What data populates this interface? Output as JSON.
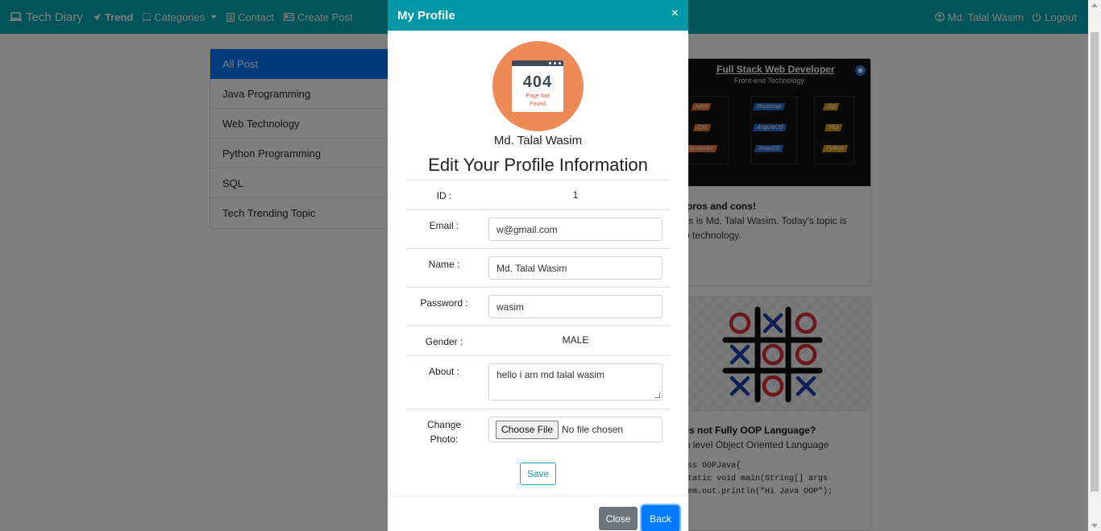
{
  "navbar": {
    "brand": "Tech Diary",
    "trend": "Trend",
    "categories": "Categories",
    "contact": "Contact",
    "create_post": "Create Post",
    "user": "Md. Talal Wasim",
    "logout": "Logout"
  },
  "categories_list": [
    "All Post",
    "Java Programming",
    "Web Technology",
    "Python Programming",
    "SQL",
    "Tech Trending Topic"
  ],
  "posts": [
    {
      "banner_title": "Full Stack Web Developer",
      "banner_subtitle": "Front-end Technology",
      "banner_tags": [
        "Html",
        "Css",
        "Javascript",
        "Bootstrap",
        "AngularJS",
        "ReactJS",
        "Sql",
        "Php",
        "Python"
      ],
      "title": "Web Tech pros and cons!",
      "text": "Hi there, this is Md. Talal Wasim. Today's topic is what is web technology.",
      "code": "no code"
    },
    {
      "title": "Why Java is not Fully OOP Language?",
      "text": "Java is high level Object Oriented Language",
      "code": "public class OOPJava{\n  public static void main(String[] args\n      System.out.println(\"Hi Java OOP\");"
    }
  ],
  "modal": {
    "title": "My Profile",
    "close_symbol": "×",
    "avatar": {
      "code": "404",
      "text_line1": "Page Not",
      "text_line2": "Found"
    },
    "name": "Md. Talal Wasim",
    "heading": "Edit Your Profile Information",
    "id_label": "ID :",
    "id_value": "1",
    "email_label": "Email :",
    "email_value": "w@gmail.com",
    "name_label": "Name :",
    "name_value": "Md. Talal Wasim",
    "password_label": "Password :",
    "password_value": "wasim",
    "gender_label": "Gender :",
    "gender_value": "MALE",
    "about_label": "About :",
    "about_value": "hello i am md talal wasim",
    "photo_label_line1": "Change",
    "photo_label_line2": "Photo:",
    "file_button": "Choose File",
    "file_status": "No file chosen",
    "save": "Save",
    "close": "Close",
    "back": "Back"
  },
  "colors": {
    "navbar": "#00a6b1",
    "modal_header": "#0097a7",
    "primary": "#007bff",
    "secondary": "#6c757d",
    "avatar_bg": "#ee8a55"
  }
}
